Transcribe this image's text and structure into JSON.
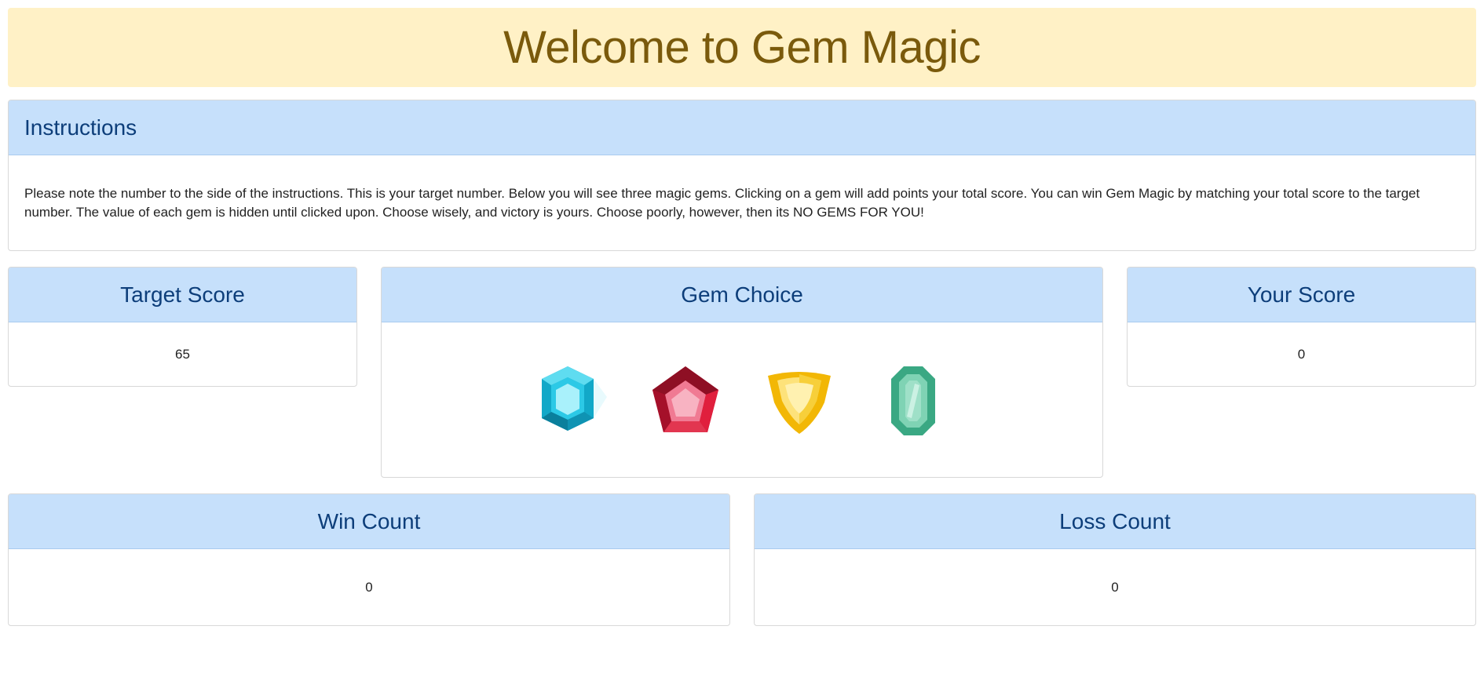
{
  "header": {
    "title": "Welcome to Gem Magic"
  },
  "instructions": {
    "heading": "Instructions",
    "text": "Please note the number to the side of the instructions. This is your target number. Below you will see three magic gems. Clicking on a gem will add points your total score. You can win Gem Magic by matching your total score to the target number. The value of each gem is hidden until clicked upon. Choose wisely, and victory is yours. Choose poorly, however, then its NO GEMS FOR YOU!"
  },
  "target": {
    "heading": "Target Score",
    "value": "65"
  },
  "gem_choice": {
    "heading": "Gem Choice",
    "gems": [
      {
        "name": "blue-gem-icon",
        "color": "#1fb6d6"
      },
      {
        "name": "red-gem-icon",
        "color": "#d4213f"
      },
      {
        "name": "yellow-gem-icon",
        "color": "#f5c21b"
      },
      {
        "name": "green-gem-icon",
        "color": "#4fbf9a"
      }
    ]
  },
  "your_score": {
    "heading": "Your Score",
    "value": "0"
  },
  "wins": {
    "heading": "Win Count",
    "value": "0"
  },
  "losses": {
    "heading": "Loss Count",
    "value": "0"
  }
}
